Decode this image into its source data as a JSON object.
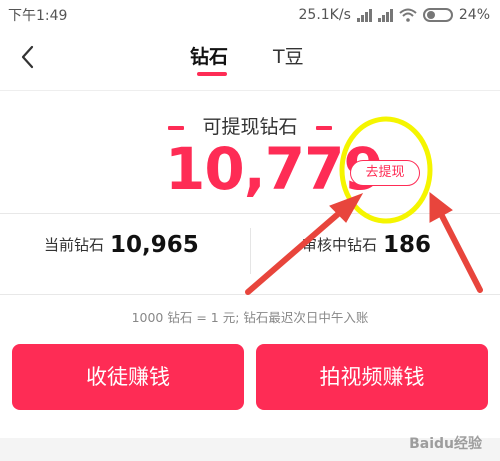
{
  "status_bar": {
    "time": "下午1:49",
    "net_speed": "25.1K/s",
    "battery": "24%"
  },
  "nav": {
    "tabs": [
      {
        "label": "钻石",
        "active": true
      },
      {
        "label": "T豆",
        "active": false
      }
    ]
  },
  "withdrawable": {
    "label": "可提现钻石",
    "amount": "10,779",
    "button": "去提现"
  },
  "stats": {
    "current_label": "当前钻石",
    "current_value": "10,965",
    "review_label": "审核中钻石",
    "review_value": "186"
  },
  "note": "1000 钻石 = 1 元; 钻石最迟次日中午入账",
  "actions": {
    "left": "收徒赚钱",
    "right": "拍视频赚钱"
  },
  "watermark": "Baidu经验",
  "colors": {
    "accent": "#fe2c55",
    "highlight": "#f5f500",
    "arrow": "#e8453c"
  }
}
